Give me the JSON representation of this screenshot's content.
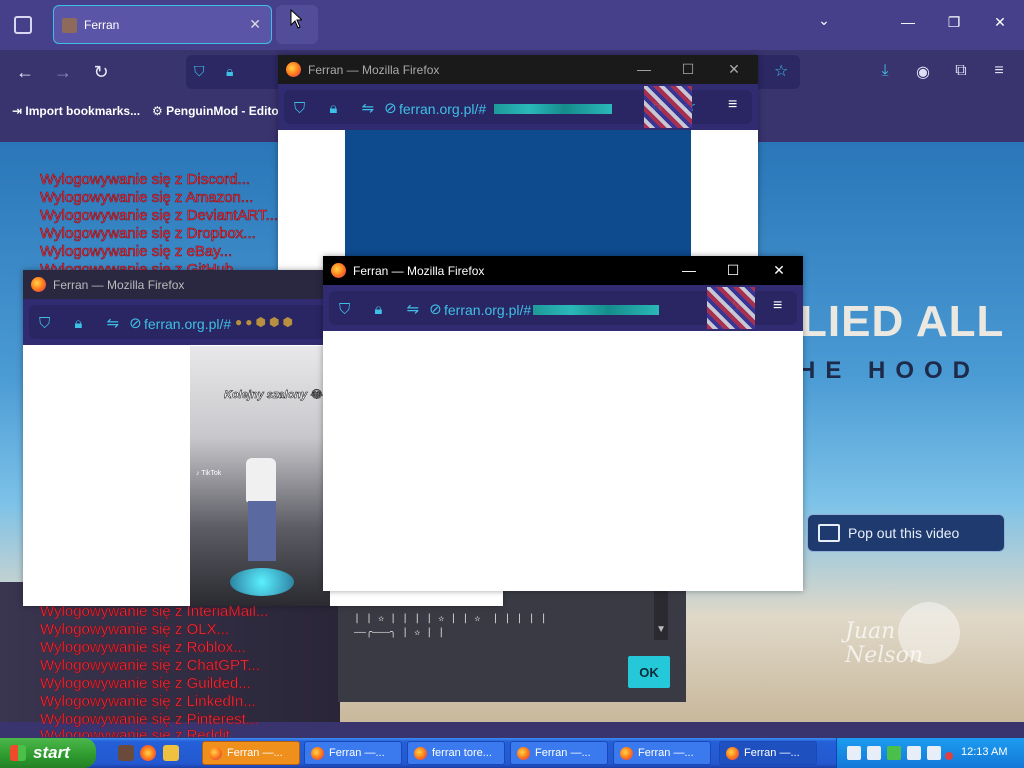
{
  "main_window": {
    "tab_label": "Ferran",
    "tab_close": "✕",
    "min": "—",
    "max": "❐",
    "close": "✕",
    "chevron": "⌄",
    "bookmarks": [
      "Import bookmarks...",
      "PenguinMod - Edito"
    ]
  },
  "spam_lines": [
    "Wylogowywanie się z Discord...",
    "Wylogowywanie się z Amazon...",
    "Wylogowywanie się z DeviantART...",
    "Wylogowywanie się z Dropbox...",
    "Wylogowywanie się z eBay...",
    "Wylogowywanie się z GitHub..."
  ],
  "spam_lines_bottom": [
    "Wylogowywanie się z InteriaMail...",
    "Wylogowywanie się z OLX...",
    "Wylogowywanie się z Roblox...",
    "Wylogowywanie się z ChatGPT...",
    "Wylogowywanie się z Guilded...",
    "Wylogowywanie się z LinkedIn...",
    "Wylogowywanie się z Pinterest...",
    "Wylogowywanie się z Reddit..."
  ],
  "hero": {
    "line1": "LIED ALL",
    "line2": "HE HOOD"
  },
  "popout_label": "Pop out this video",
  "popup_windows": {
    "a": {
      "title": "Ferran — Mozilla Firefox",
      "url": "ferran.org.pl/#"
    },
    "b": {
      "title": "Ferran — Mozilla Firefox",
      "url": "ferran.org.pl/#",
      "video_caption": "Kolejny szalony 😂"
    },
    "c": {
      "title": "Ferran — Mozilla Firefox",
      "url": "ferran.org.pl/#"
    }
  },
  "dialog": {
    "glyph_line1": "| | ✫ | | | | ✫ | | ✫  | | | | |",
    "glyph_line2": "——╭———╮ | ✫ | |",
    "ok_label": "OK"
  },
  "taskbar": {
    "start_label": "start",
    "buttons": [
      "Ferran —...",
      "Ferran —...",
      "ferran tore...",
      "Ferran —...",
      "Ferran —...",
      "Ferran —..."
    ],
    "clock": "12:13 AM"
  }
}
